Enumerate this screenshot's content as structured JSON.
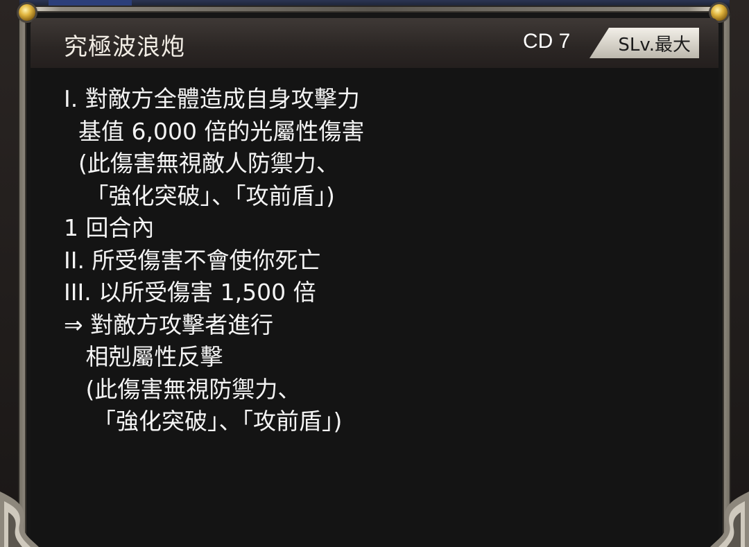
{
  "skill": {
    "name": "究極波浪炮",
    "cd_label": "CD 7",
    "skill_level_badge": "SLv.最大"
  },
  "description_lines": [
    "I. 對敵方全體造成自身攻擊力",
    "  基值 6,000 倍的光屬性傷害",
    "  (此傷害無視敵人防禦力、",
    "   「強化突破」、「攻前盾」)",
    "1 回合內",
    "II. 所受傷害不會使你死亡",
    "III. 以所受傷害 1,500 倍",
    "⇒ 對敵方攻擊者進行",
    "   相剋屬性反擊",
    "   (此傷害無視防禦力、",
    "    「強化突破」、「攻前盾」)"
  ],
  "colors": {
    "text": "#f4f4f4",
    "header_bg": "#2b2624",
    "panel_bg": "#141414",
    "frame_silver": "#c8c2b5",
    "bolt_gold": "#e1b640"
  },
  "icons": [
    "gold-bolt-icon",
    "gold-bolt-icon"
  ]
}
